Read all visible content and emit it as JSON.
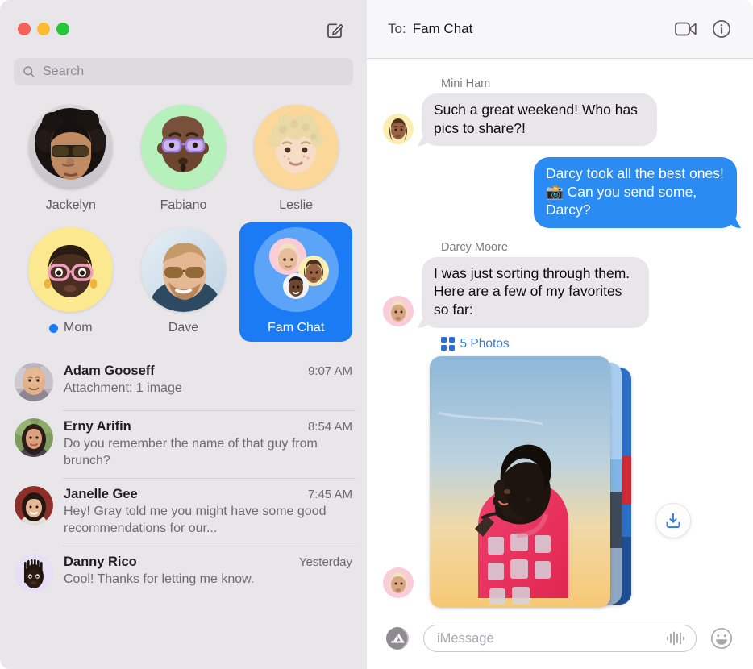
{
  "window": {
    "traffic_lights": [
      {
        "name": "close",
        "color": "#f6605b"
      },
      {
        "name": "minimize",
        "color": "#fdbc2d"
      },
      {
        "name": "zoom",
        "color": "#25c63a"
      }
    ]
  },
  "sidebar": {
    "compose_icon": "compose-pencil-square-icon",
    "search": {
      "placeholder": "Search",
      "icon": "search-icon"
    },
    "pinned": [
      {
        "name": "Jackelyn",
        "unread": false,
        "avatar_type": "photo-woman-sunglasses",
        "bg": "#1c1b1b"
      },
      {
        "name": "Fabiano",
        "unread": false,
        "avatar_type": "memoji-bald-purple-glasses",
        "bg": "#b6f0bb"
      },
      {
        "name": "Leslie",
        "unread": false,
        "avatar_type": "memoji-blond-curly",
        "bg": "#fcd79a"
      },
      {
        "name": "Mom",
        "unread": true,
        "avatar_type": "memoji-pink-glasses",
        "bg": "#fce98f"
      },
      {
        "name": "Dave",
        "unread": false,
        "avatar_type": "photo-man-sunglasses",
        "bg": "#cfe0ef"
      },
      {
        "name": "Fam Chat",
        "unread": false,
        "avatar_type": "group-memoji-trio",
        "bg": "#5ca4f7",
        "selected": true
      }
    ],
    "conversations": [
      {
        "name": "Adam Gooseff",
        "time": "9:07 AM",
        "preview": "Attachment: 1 image",
        "avatar_type": "photo-bald-man"
      },
      {
        "name": "Erny Arifin",
        "time": "8:54 AM",
        "preview": "Do you remember the name of that guy from brunch?",
        "avatar_type": "photo-woman-dark-hair"
      },
      {
        "name": "Janelle Gee",
        "time": "7:45 AM",
        "preview": "Hey! Gray told me you might have some good recommendations for our...",
        "avatar_type": "photo-woman-bob"
      },
      {
        "name": "Danny Rico",
        "time": "Yesterday",
        "preview": "Cool! Thanks for letting me know.",
        "avatar_type": "memoji-dreadlocks"
      }
    ]
  },
  "chat": {
    "header": {
      "to_label": "To:",
      "recipient": "Fam Chat",
      "facetime_icon": "video-camera-icon",
      "details_icon": "info-circle-icon"
    },
    "messages": [
      {
        "id": "m1",
        "direction": "in",
        "sender": "Mini Ham",
        "text": "Such a great weekend! Who has pics to share?!",
        "avatar_type": "memoji-braids-yellow"
      },
      {
        "id": "m2",
        "direction": "out",
        "sender": "",
        "text": "Darcy took all the best ones! 📸 Can you send some, Darcy?"
      },
      {
        "id": "m3",
        "direction": "in",
        "sender": "Darcy Moore",
        "text": "I was just sorting through them. Here are a few of my favorites so far:",
        "avatar_type": "memoji-blond-pink"
      }
    ],
    "attachment": {
      "count_label": "5 Photos",
      "grid_icon": "photo-grid-icon",
      "download_icon": "download-tray-icon",
      "avatar_type": "memoji-blond-pink"
    },
    "composer": {
      "apps_icon": "app-store-icon",
      "placeholder": "iMessage",
      "audio_icon": "audio-waveform-icon",
      "emoji_icon": "smiley-face-icon"
    }
  },
  "colors": {
    "accent_blue": "#2a8bf2",
    "pin_selected_blue": "#1a7bf5",
    "sidebar_bg": "#e8e6e9",
    "in_bubble": "#e8e6ea",
    "link_blue": "#3a7bd0"
  }
}
